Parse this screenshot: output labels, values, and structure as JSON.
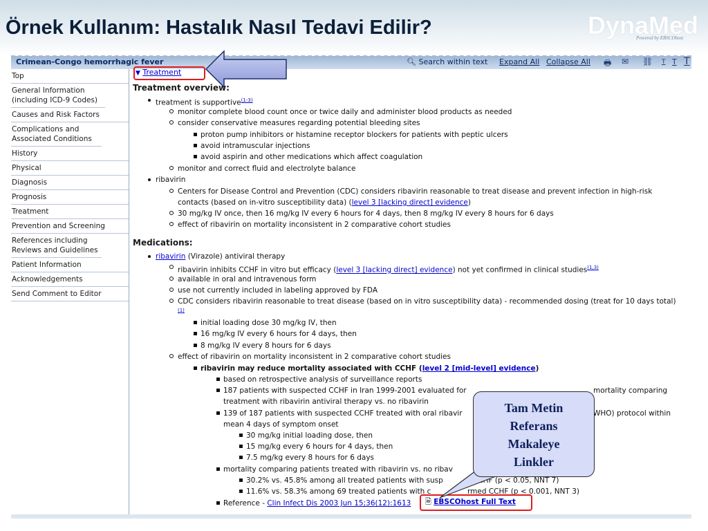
{
  "slide": {
    "title": "Örnek Kullanım:  Hastalık Nasıl Tedavi Edilir?",
    "logo": {
      "name": "DynaMed",
      "sub": "Powered by EBSCOhost"
    },
    "callout": [
      "Tam Metin",
      "Referans",
      "Makaleye",
      "Linkler"
    ]
  },
  "toolbar": {
    "title": "Crimean-Congo hemorrhagic fever",
    "search": "Search within text",
    "expand": "Expand All",
    "collapse": "Collapse All",
    "icons": [
      "print-icon",
      "email-icon",
      "link-icon",
      "font-small-icon",
      "font-medium-icon",
      "font-large-icon"
    ],
    "font_sizes": [
      "T",
      "T",
      "T"
    ]
  },
  "sidebar": {
    "items": [
      "Top",
      "General Information (including ICD-9 Codes)",
      "Causes and Risk Factors",
      "Complications and Associated Conditions",
      "History",
      "Physical",
      "Diagnosis",
      "Prognosis",
      "Treatment",
      "Prevention and Screening",
      "References including Reviews and Guidelines",
      "Patient Information",
      "Acknowledgements",
      "Send Comment to Editor"
    ]
  },
  "content": {
    "section_link": "Treatment",
    "overview_heading": "Treatment overview:",
    "medications_heading": "Medications:",
    "lines": {
      "o1": "treatment is supportive",
      "o1_ref": "(1-3)",
      "o2": "monitor complete blood count once or twice daily and administer blood products as needed",
      "o3": "consider conservative measures regarding potential bleeding sites",
      "o4": "proton pump inhibitors or histamine receptor blockers for patients with peptic ulcers",
      "o5": "avoid intramuscular injections",
      "o6": "avoid aspirin and other medications which affect coagulation",
      "o7": "monitor and correct fluid and electrolyte balance",
      "o8": "ribavirin",
      "o9a": "Centers for Disease Control and Prevention (CDC) considers ribavirin reasonable to treat disease and prevent infection in high-risk",
      "o9b": "contacts (based on in-vitro susceptibility data) (",
      "o9_link": "level 3 [lacking direct] evidence",
      "o9c": ")",
      "o10": "30 mg/kg IV once, then 16 mg/kg IV every 6 hours for 4 days, then 8 mg/kg IV every 8 hours for 6 days",
      "o11": "effect of ribavirin on mortality inconsistent in 2 comparative cohort studies",
      "m1_link": "ribavirin",
      "m1": " (Virazole) antiviral therapy",
      "m2a": "ribavirin inhibits CCHF in vitro but efficacy (",
      "m2_link": "level 3 [lacking direct] evidence",
      "m2b": ") not yet confirmed in clinical studies",
      "m2_ref": "(1,3)",
      "m3": "available in oral and intravenous form",
      "m4": "use not currently included in labeling approved by FDA",
      "m5": "CDC considers ribavirin reasonable to treat disease (based on in vitro susceptibility data) - recommended dosing (treat for 10 days total)",
      "m5_ref": "(1)",
      "m6": "initial loading dose 30 mg/kg IV, then",
      "m7": "16 mg/kg IV every 6 hours for 4 days, then",
      "m8": "8 mg/kg IV every 8 hours for 6 days",
      "m9": "effect of ribavirin on mortality inconsistent in 2 comparative cohort studies",
      "m10a": "ribavirin may reduce mortality associated with CCHF (",
      "m10_link": "level 2 [mid-level] evidence",
      "m10b": ")",
      "m11": "based on retrospective analysis of surveillance reports",
      "m12a": "187 patients with suspected CCHF in Iran 1999-2001 evaluated for",
      "m12b": "mortality comparing",
      "m12c": "treatment with ribavirin antiviral therapy vs. no ribavirin",
      "m13a": "139 of 187 patients with suspected CCHF treated with oral ribavir",
      "m13b": "WHO) protocol within",
      "m13c": "mean 4 days of symptom onset",
      "m14": "30 mg/kg initial loading dose, then",
      "m15": "15 mg/kg every 6 hours for 4 days, then",
      "m16": "7.5 mg/kg every 8 hours for 6 days",
      "m17": "mortality comparing patients treated with ribavirin vs. no ribav",
      "m18a": "30.2% vs. 45.8% among all treated patients with susp",
      "m18b": "CCHF (p < 0.05, NNT 7)",
      "m19a": "11.6% vs. 58.3% among 69 treated patients with c",
      "m19b": "rmed CCHF (p < 0.001, NNT 3)",
      "ref_prefix": "Reference - ",
      "ref_link": "Clin Infect Dis 2003 Jun 15;36(12):1613",
      "ebsco_link": "EBSCOhost Full Text"
    }
  }
}
